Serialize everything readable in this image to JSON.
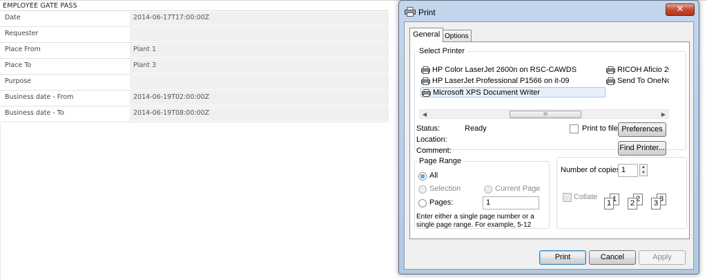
{
  "form": {
    "title": "EMPLOYEE GATE PASS",
    "rows": [
      {
        "label": "Date",
        "value": "2014-06-17T17:00:00Z"
      },
      {
        "label": "Requester",
        "value": ""
      },
      {
        "label": "Place From",
        "value": "Plant 1"
      },
      {
        "label": "Place To",
        "value": "Plant 3"
      },
      {
        "label": "Purpose",
        "value": ""
      },
      {
        "label": "Business date - From",
        "value": "2014-06-19T02:00:00Z"
      },
      {
        "label": "Business date - To",
        "value": "2014-06-19T08:00:00Z"
      }
    ]
  },
  "dialog": {
    "title": "Print",
    "close_glyph": "✕",
    "tabs": {
      "general": "General",
      "options": "Options"
    },
    "select_printer": {
      "legend": "Select Printer",
      "printers": [
        "HP Color LaserJet 2600n on RSC-CAWDS",
        "HP LaserJet Professional P1566 on it-09",
        "Microsoft XPS Document Writer",
        "RICOH Aficio 20",
        "Send To OneNo"
      ],
      "selected": "Microsoft XPS Document Writer",
      "scroll_left": "◀",
      "scroll_right": "▶",
      "scroll_grip": "III",
      "status_label": "Status:",
      "status_value": "Ready",
      "location_label": "Location:",
      "comment_label": "Comment:",
      "print_to_file": "Print to file",
      "preferences": "Preferences",
      "find_printer": "Find Printer..."
    },
    "page_range": {
      "legend": "Page Range",
      "all": "All",
      "selection": "Selection",
      "current_page": "Current Page",
      "pages": "Pages:",
      "pages_value": "1",
      "hint": "Enter either a single page number or a single page range.  For example, 5-12"
    },
    "copies": {
      "label": "Number of copies:",
      "value": "1",
      "up": "▲",
      "down": "▼",
      "collate": "Collate",
      "sheet_labels": [
        "1",
        "1",
        "2",
        "2",
        "3",
        "3"
      ]
    },
    "buttons": {
      "print": "Print",
      "cancel": "Cancel",
      "apply": "Apply"
    }
  },
  "colors": {
    "dialog_frame": "#b1c8e4",
    "close": "#c44a32",
    "selection": "#e7f0fa"
  }
}
